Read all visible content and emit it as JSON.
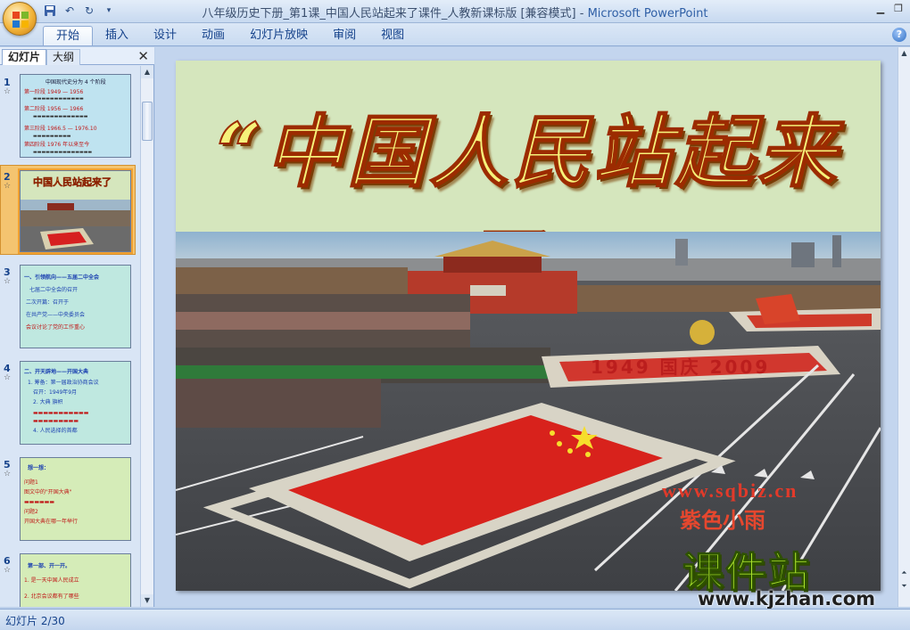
{
  "window": {
    "title": "八年级历史下册_第1课_中国人民站起来了课件_人教新课标版 [兼容模式]",
    "separator": " - ",
    "app_name": "Microsoft PowerPoint"
  },
  "ribbon": {
    "tabs": [
      {
        "label": "开始",
        "active": true
      },
      {
        "label": "插入"
      },
      {
        "label": "设计"
      },
      {
        "label": "动画"
      },
      {
        "label": "幻灯片放映"
      },
      {
        "label": "审阅"
      },
      {
        "label": "视图"
      }
    ]
  },
  "left_pane": {
    "tab_slides": "幻灯片",
    "tab_outline": "大纲",
    "selected_slide": 2,
    "thumbnails": [
      {
        "num": "1",
        "lines": [
          "中国现代史分为 4 个阶段",
          "第一阶段 1949 — 1956",
          "第二阶段 1956 — 1966",
          "第三阶段 1966.5 — 1976.10",
          "第四阶段 1976 年以来至今"
        ]
      },
      {
        "num": "2",
        "title": "中国人民站起来了"
      },
      {
        "num": "3",
        "lines": [
          "一、引领航向——五届二中全会",
          "七届二中全会的召开",
          "二次开篇：召开于",
          "在共产党——中央委员会",
          "会议讨论了党的工作重心"
        ]
      },
      {
        "num": "4",
        "lines": [
          "二、开天辟地——开国大典",
          "1. 筹备：第一届政治协商会议",
          "召开：1949年9月",
          "2. 大典 旗帜",
          "4. 人民选择的首都"
        ]
      },
      {
        "num": "5",
        "lines": [
          "想一想：",
          "问题1",
          "图文中的\"开国大典\"",
          "问题2",
          "开国大典在哪一年举行"
        ]
      },
      {
        "num": "6",
        "lines": [
          "第一部、开一开。",
          "1. 是一天中国人民成立",
          "2. 北京会议都有了哪些"
        ]
      }
    ]
  },
  "slide": {
    "title": "“中国人民站起来了”",
    "photo_caption": "1949 国庆 2009",
    "watermark_url": "www.sqbiz.cn",
    "watermark_name": "紫色小雨"
  },
  "brand": {
    "name": "课件站",
    "url": "www.kjzhan.com"
  },
  "status": {
    "slide_indicator": "幻灯片 2/30"
  }
}
